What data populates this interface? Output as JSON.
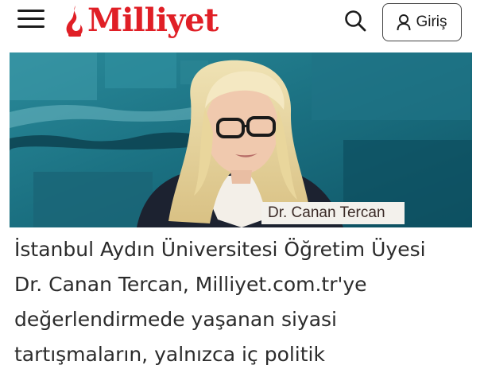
{
  "header": {
    "logo_text": "Milliyet",
    "login_label": "Giriş",
    "brand_color": "#e01f26",
    "icons": [
      "menu-icon",
      "search-icon",
      "user-icon"
    ]
  },
  "hero": {
    "caption": "Dr. Canan Tercan"
  },
  "article": {
    "lines": [
      "İstanbul Aydın Üniversitesi Öğretim Üyesi",
      "Dr. Canan Tercan, Milliyet.com.tr'ye",
      "değerlendirmede yaşanan siyasi",
      "tartışmaların, yalnızca iç politik"
    ]
  }
}
